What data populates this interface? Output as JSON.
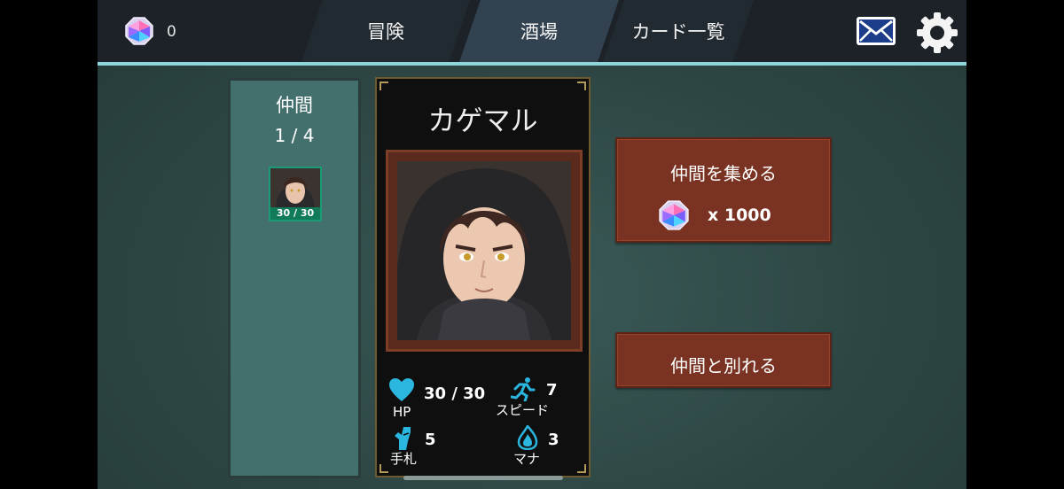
{
  "header": {
    "gem_count": "0",
    "tabs": [
      {
        "label": "冒険",
        "active": false
      },
      {
        "label": "酒場",
        "active": true
      },
      {
        "label": "カード一覧",
        "active": false
      }
    ],
    "mail_icon": "mail-icon",
    "settings_icon": "gear-icon",
    "accent_color": "#8fd6dc"
  },
  "party": {
    "title": "仲間",
    "count": "1 / 4",
    "members": [
      {
        "hp_label": "30 / 30"
      }
    ]
  },
  "character": {
    "name": "カゲマル",
    "stats": {
      "hp": {
        "label": "HP",
        "value": "30 / 30",
        "icon": "heart-icon"
      },
      "speed": {
        "label": "スピード",
        "value": "7",
        "icon": "running-icon"
      },
      "hand": {
        "label": "手札",
        "value": "5",
        "icon": "hand-icon"
      },
      "mana": {
        "label": "マナ",
        "value": "3",
        "icon": "flame-icon"
      }
    }
  },
  "actions": {
    "recruit": {
      "label": "仲間を集める",
      "cost": "x 1000",
      "cost_icon": "gem-icon"
    },
    "dismiss": {
      "label": "仲間と別れる"
    }
  },
  "colors": {
    "button": "#7a3322",
    "stat_icon": "#2bb6e0",
    "panel": "#43706d"
  }
}
